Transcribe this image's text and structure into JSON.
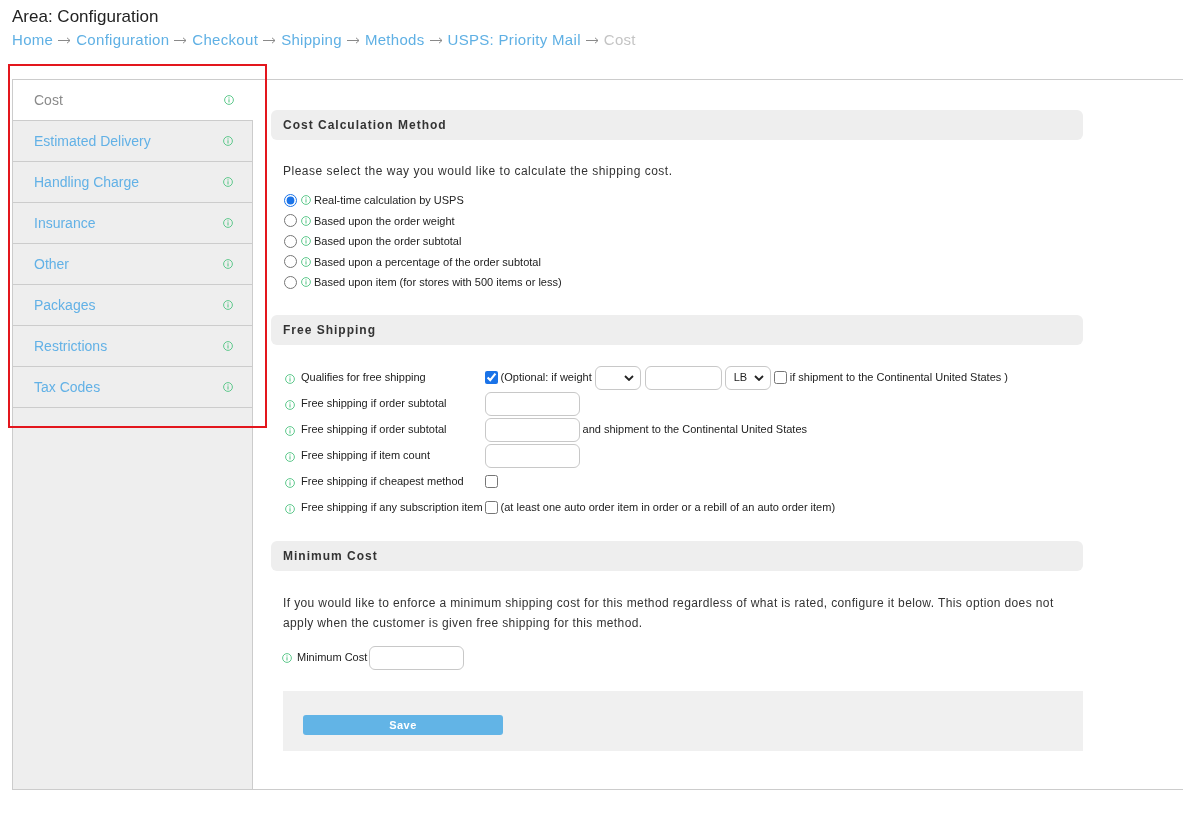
{
  "header": {
    "title": "Area: Configuration"
  },
  "breadcrumb": [
    {
      "label": "Home",
      "current": false
    },
    {
      "label": "Configuration",
      "current": false
    },
    {
      "label": "Checkout",
      "current": false
    },
    {
      "label": "Shipping",
      "current": false
    },
    {
      "label": "Methods",
      "current": false
    },
    {
      "label": "USPS: Priority Mail",
      "current": false
    },
    {
      "label": "Cost",
      "current": true
    }
  ],
  "sidebar": {
    "items": [
      {
        "label": "Cost",
        "selected": true
      },
      {
        "label": "Estimated Delivery",
        "selected": false
      },
      {
        "label": "Handling Charge",
        "selected": false
      },
      {
        "label": "Insurance",
        "selected": false
      },
      {
        "label": "Other",
        "selected": false
      },
      {
        "label": "Packages",
        "selected": false
      },
      {
        "label": "Restrictions",
        "selected": false
      },
      {
        "label": "Tax Codes",
        "selected": false
      }
    ]
  },
  "sections": [
    {
      "kind": "radio_group",
      "title": "Cost Calculation Method",
      "intro": "Please select the way you would like to calculate the shipping cost.",
      "options": [
        {
          "label": "Real-time calculation by USPS",
          "selected": true
        },
        {
          "label": "Based upon the order weight",
          "selected": false
        },
        {
          "label": "Based upon the order subtotal",
          "selected": false
        },
        {
          "label": "Based upon a percentage of the order subtotal",
          "selected": false
        },
        {
          "label": "Based upon item (for stores with 500 items or less)",
          "selected": false
        }
      ]
    },
    {
      "kind": "free_shipping",
      "title": "Free Shipping",
      "rows": [
        {
          "label": "Qualifies for free shipping",
          "controls": [
            {
              "kind": "checkbox",
              "checked": true
            },
            {
              "kind": "text",
              "text": "(Optional: if weight"
            },
            {
              "kind": "select"
            },
            {
              "kind": "narrow_input"
            },
            {
              "kind": "select",
              "value": "LB"
            },
            {
              "kind": "checkbox",
              "checked": false
            },
            {
              "kind": "text",
              "text": "if shipment to the Continental United States )"
            }
          ]
        },
        {
          "label": "Free shipping if order subtotal",
          "controls": [
            {
              "kind": "input"
            }
          ]
        },
        {
          "label": "Free shipping if order subtotal",
          "controls": [
            {
              "kind": "input"
            },
            {
              "kind": "text",
              "text": "and shipment to the Continental United States"
            }
          ]
        },
        {
          "label": "Free shipping if item count",
          "controls": [
            {
              "kind": "input"
            }
          ]
        },
        {
          "label": "Free shipping if cheapest method",
          "controls": [
            {
              "kind": "checkbox",
              "checked": false
            }
          ]
        },
        {
          "label": "Free shipping if any subscription item",
          "controls": [
            {
              "kind": "checkbox",
              "checked": false
            },
            {
              "kind": "text",
              "text": "(at least one auto order item in order or a rebill of an auto order item)"
            }
          ]
        }
      ]
    },
    {
      "kind": "minimum_cost",
      "title": "Minimum Cost",
      "intro": "If you would like to enforce a minimum shipping cost for this method regardless of what is rated, configure it below. This option does not apply when the customer is given free shipping for this method.",
      "field": {
        "label": "Minimum Cost"
      }
    }
  ],
  "save_button": {
    "label": "Save"
  }
}
